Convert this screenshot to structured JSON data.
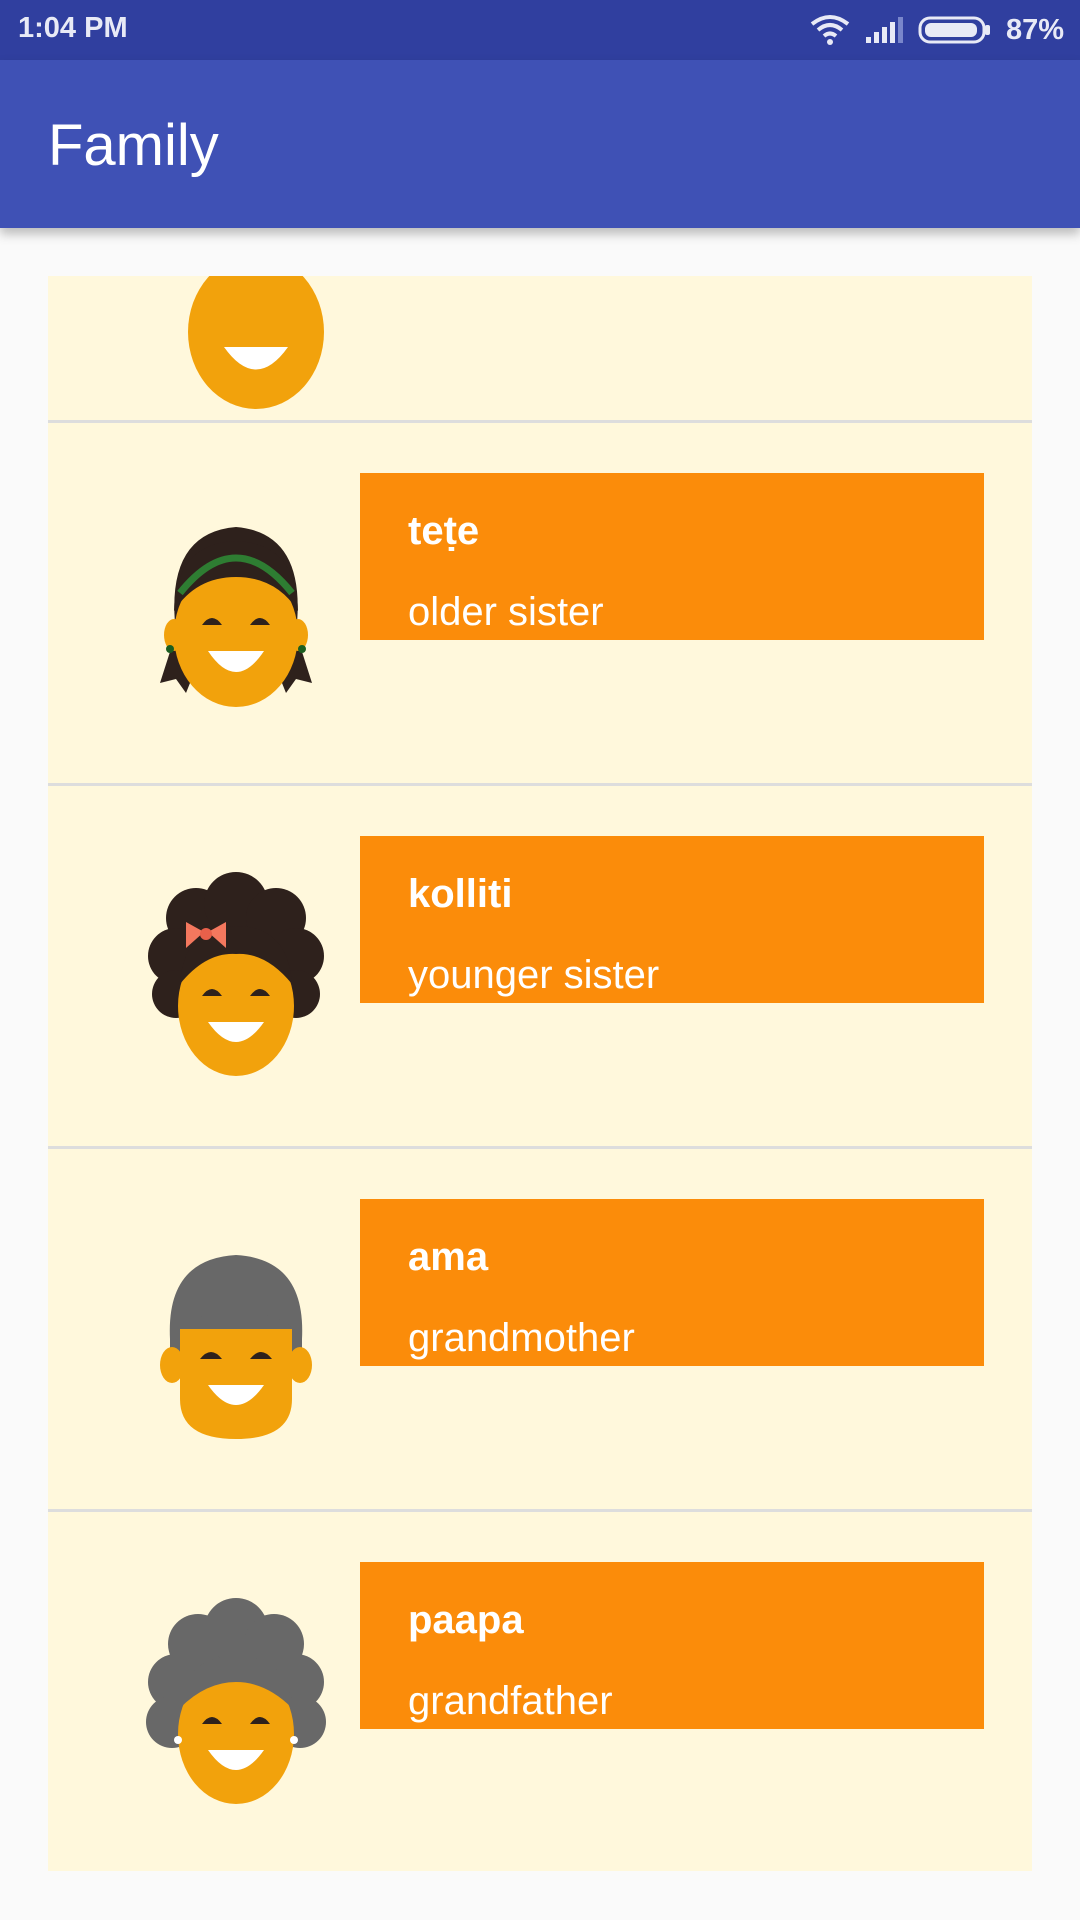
{
  "status_bar": {
    "time": "1:04 PM",
    "battery": "87%",
    "icons": [
      "wifi-icon",
      "signal-icon",
      "battery-icon"
    ]
  },
  "app_bar": {
    "title": "Family"
  },
  "colors": {
    "status_bar": "#303f9f",
    "app_bar": "#3f51b5",
    "list_background": "#fff8dc",
    "card": "#fb8c0a"
  },
  "items": [
    {
      "word": "teṭe",
      "translation": "older sister",
      "icon": "older-sister-avatar-icon"
    },
    {
      "word": "kolliti",
      "translation": "younger sister",
      "icon": "younger-sister-avatar-icon"
    },
    {
      "word": "ama",
      "translation": "grandmother",
      "icon": "grandmother-avatar-icon"
    },
    {
      "word": "paapa",
      "translation": "grandfather",
      "icon": "grandfather-avatar-icon"
    }
  ]
}
